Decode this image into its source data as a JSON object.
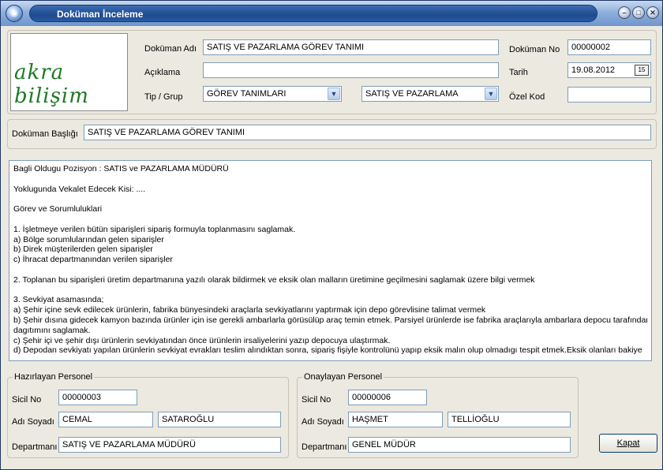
{
  "window": {
    "title": "Doküman İnceleme"
  },
  "logo": {
    "text": "akra bilişim"
  },
  "header": {
    "doc_name_label": "Doküman Adı",
    "doc_name": "SATIŞ VE PAZARLAMA GÖREV TANIMI",
    "description_label": "Açıklama",
    "description": "",
    "type_group_label": "Tip / Grup",
    "type": "GÖREV TANIMLARI",
    "group": "SATIŞ VE PAZARLAMA",
    "doc_no_label": "Doküman No",
    "doc_no": "00000002",
    "date_label": "Tarih",
    "date": "19.08.2012",
    "special_code_label": "Özel Kod",
    "special_code": ""
  },
  "doc_title": {
    "label": "Doküman Başlığı",
    "value": "SATIŞ VE PAZARLAMA GÖREV TANIMI"
  },
  "doc_body": [
    "Bagli Oldugu Pozisyon : SATIS ve PAZARLAMA MÜDÜRÜ",
    "",
    "Yoklugunda Vekalet Edecek Kisi: ....",
    "",
    "Görev ve Sorumluluklari",
    "",
    "1. İşletmeye verilen bütün siparişleri sipariş formuyla toplanmasını saglamak.",
    "a) Bölge sorumlularından gelen siparişler",
    "b) Direk müşterilerden gelen siparişler",
    "c) İhracat departmanından verilen siparişler",
    "",
    "2. Toplanan bu siparişleri üretim departmanına yazılı olarak bildirmek ve eksik olan malların üretimine geçilmesini saglamak üzere bilgi vermek",
    "",
    "3. Sevkiyat asamasında;",
    "a) Şehir içine sevk edilecek ürünlerin, fabrika bünyesindeki araçlarla sevkiyatlarını yaptırmak için depo görevlisine talimat vermek",
    "b) Şehir dısına gidecek kamyon bazında ürünler için ise gerekli ambarlarla görüsülüp araç temin etmek. Parsiyel ürünlerde ise fabrika araçlarıyla ambarlara depocu tarafından",
    "dagıtımını saglamak.",
    "c) Şehir içi ve şehir dışı ürünlerin sevkiyatından önce ürünlerin irsaliyelerini yazıp depocuya ulaştırmak.",
    "d) Depodan sevkiyatı yapılan ürünlerin sevkiyat evrakları teslim alındıktan sonra, sipariş fişiyle kontrolünü yapıp eksik malın olup olmadıgı tespit etmek.Eksik olanları bakiye"
  ],
  "prepared": {
    "title": "Hazırlayan Personel",
    "id_label": "Sicil No",
    "id": "00000003",
    "name_label": "Adı Soyadı",
    "first_name": "CEMAL",
    "last_name": "SATAROĞLU",
    "dept_label": "Departmanı",
    "dept": "SATIŞ VE PAZARLAMA MÜDÜRÜ"
  },
  "approved": {
    "title": "Onaylayan Personel",
    "id_label": "Sicil No",
    "id": "00000006",
    "name_label": "Adı Soyadı",
    "first_name": "HAŞMET",
    "last_name": "TELLİOĞLU",
    "dept_label": "Departmanı",
    "dept": "GENEL MÜDÜR"
  },
  "close_button": "Kapat"
}
